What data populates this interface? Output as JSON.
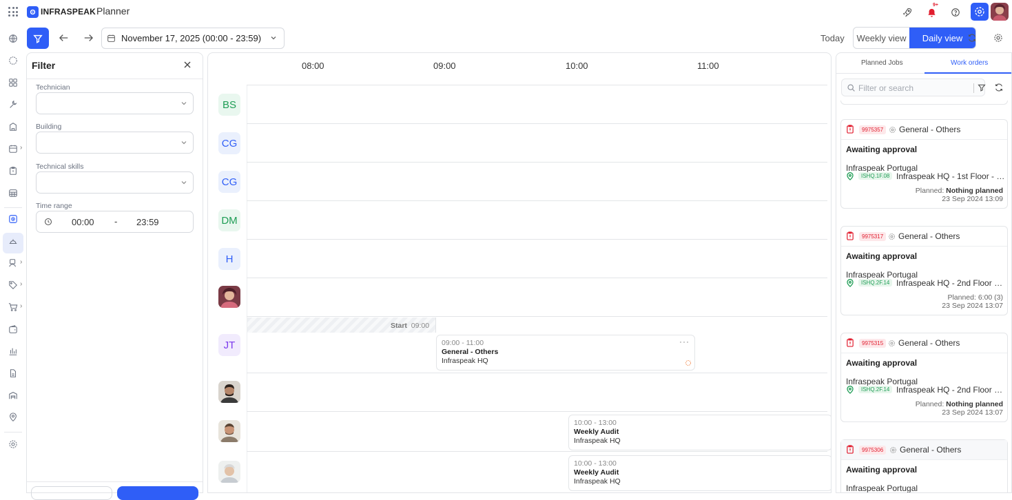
{
  "app": {
    "brand": "INFRASPEAK",
    "title": "Planner"
  },
  "header": {
    "notif_count": "9+"
  },
  "toolbar": {
    "date_range": "November 17, 2025 (00:00 - 23:59)",
    "today": "Today",
    "weekly_view": "Weekly view",
    "daily_view": "Daily view"
  },
  "filter": {
    "title": "Filter",
    "technician_label": "Technician",
    "building_label": "Building",
    "skills_label": "Technical skills",
    "time_range_label": "Time range",
    "time_from": "00:00",
    "time_sep": "-",
    "time_to": "23:59"
  },
  "planner": {
    "hours": [
      "08:00",
      "09:00",
      "10:00",
      "11:00"
    ],
    "technicians": [
      {
        "initials": "BS",
        "color": "green"
      },
      {
        "initials": "CG",
        "color": "blue"
      },
      {
        "initials": "CG",
        "color": "blue"
      },
      {
        "initials": "DM",
        "color": "green"
      },
      {
        "initials": "H",
        "color": "blue"
      },
      {
        "initials": "",
        "color": "photo"
      },
      {
        "initials": "JT",
        "color": "purple"
      },
      {
        "initials": "",
        "color": "photo"
      },
      {
        "initials": "",
        "color": "photo"
      },
      {
        "initials": "",
        "color": "photo"
      }
    ],
    "start_label": "Start",
    "start_time": "09:00",
    "events": [
      {
        "time": "09:00 - 11:00",
        "name": "General - Others",
        "location": "Infraspeak HQ"
      },
      {
        "time": "10:00 - 13:00",
        "name": "Weekly Audit",
        "location": "Infraspeak HQ"
      },
      {
        "time": "10:00 - 13:00",
        "name": "Weekly Audit",
        "location": "Infraspeak HQ"
      }
    ]
  },
  "right_panel": {
    "tabs": [
      "Planned Jobs",
      "Work orders"
    ],
    "search_placeholder": "Filter or search",
    "work_orders": [
      {
        "id": "9975357",
        "category": "General - Others",
        "status": "Awaiting approval",
        "client": "Infraspeak Portugal",
        "asset": "ISHQ.1F.08",
        "location": "Infraspeak HQ - 1st Floor - I...",
        "planned_label": "Planned:",
        "planned_value": "Nothing planned",
        "date": "23 Sep 2024 13:09"
      },
      {
        "id": "9975317",
        "category": "General - Others",
        "status": "Awaiting approval",
        "client": "Infraspeak Portugal",
        "asset": "ISHQ.2F.14",
        "location": "Infraspeak HQ - 2nd Floor - ...",
        "planned_label": "Planned:",
        "planned_value": "6:00 (3)",
        "date": "23 Sep 2024 13:07"
      },
      {
        "id": "9975315",
        "category": "General - Others",
        "status": "Awaiting approval",
        "client": "Infraspeak Portugal",
        "asset": "ISHQ.2F.14",
        "location": "Infraspeak HQ - 2nd Floor - ...",
        "planned_label": "Planned:",
        "planned_value": "Nothing planned",
        "date": "23 Sep 2024 13:07"
      },
      {
        "id": "9975306",
        "category": "General - Others",
        "status": "Awaiting approval",
        "client": "Infraspeak Portugal"
      }
    ]
  },
  "colors": {
    "accent": "#2f5ef7",
    "danger": "#e11d2e",
    "success": "#1f9d55"
  }
}
